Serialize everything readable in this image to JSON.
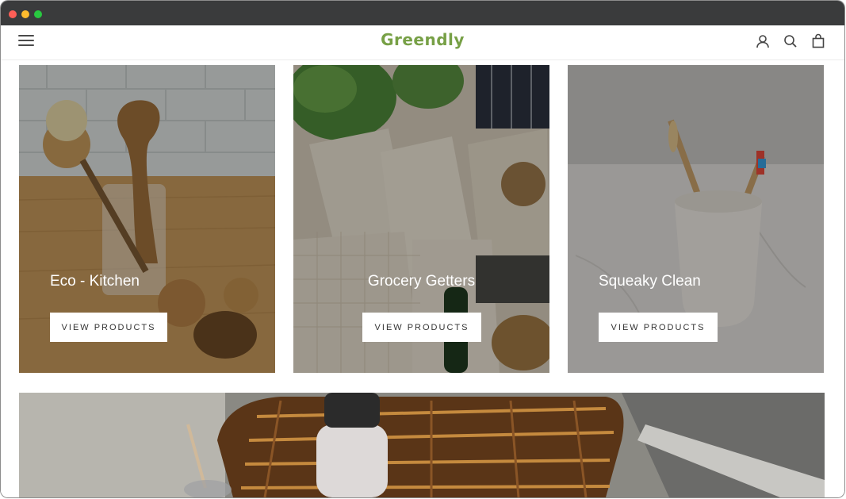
{
  "header": {
    "logo": "Greendly",
    "menu_icon": "hamburger-menu-icon",
    "account_icon": "account-icon",
    "search_icon": "search-icon",
    "cart_icon": "shopping-bag-icon"
  },
  "collections": [
    {
      "title": "Eco - Kitchen",
      "button": "VIEW PRODUCTS"
    },
    {
      "title": "Grocery Getters",
      "button": "VIEW PRODUCTS"
    },
    {
      "title": "Squeaky Clean",
      "button": "VIEW PRODUCTS"
    }
  ],
  "colors": {
    "brand": "#77a046",
    "titlebar": "#3a3b3c",
    "button_bg": "#ffffff",
    "button_text": "#333333"
  }
}
